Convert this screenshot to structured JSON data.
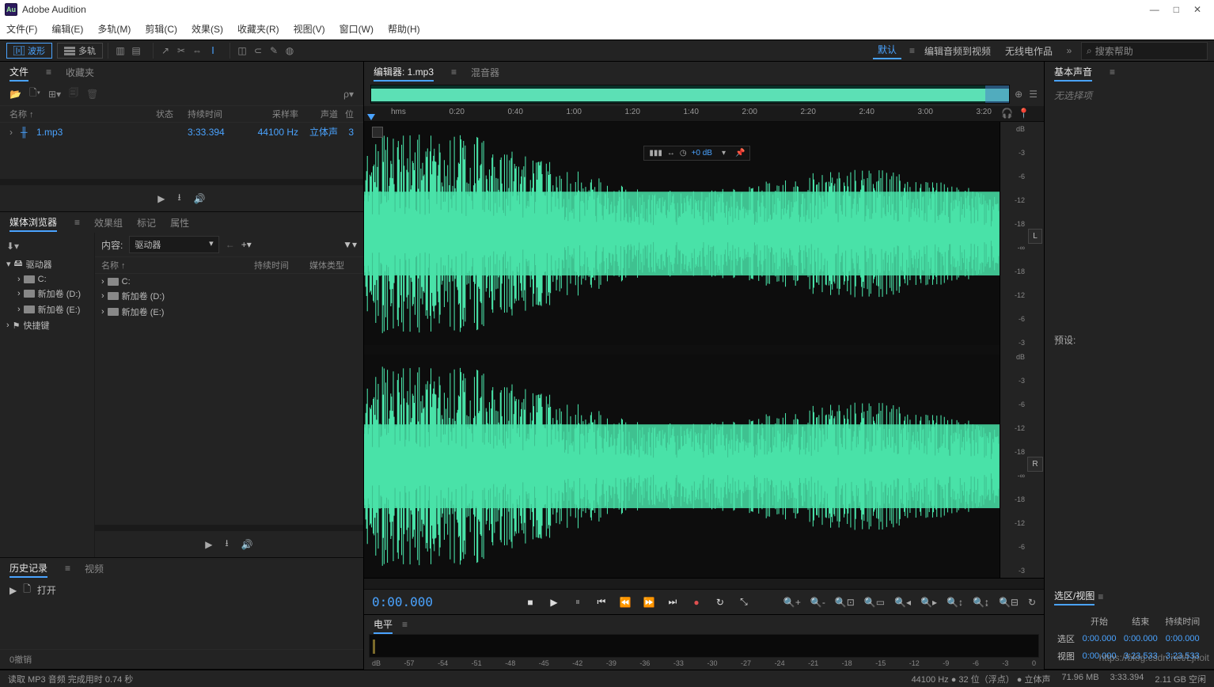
{
  "app": {
    "title": "Adobe Audition",
    "logo": "Au"
  },
  "menu": [
    "文件(F)",
    "编辑(E)",
    "多轨(M)",
    "剪辑(C)",
    "效果(S)",
    "收藏夹(R)",
    "视图(V)",
    "窗口(W)",
    "帮助(H)"
  ],
  "modes": {
    "waveform": "波形",
    "multitrack": "多轨"
  },
  "workspaces": [
    "默认",
    "编辑音频到视频",
    "无线电作品"
  ],
  "search_placeholder": "搜索帮助",
  "files_panel": {
    "tabs": [
      "文件",
      "收藏夹"
    ],
    "headers": {
      "name": "名称 ↑",
      "status": "状态",
      "duration": "持续时间",
      "sample": "采样率",
      "channels": "声道",
      "bit": "位"
    },
    "row": {
      "name": "1.mp3",
      "duration": "3:33.394",
      "sample": "44100 Hz",
      "channels": "立体声",
      "bit": "3"
    }
  },
  "media_browser": {
    "tabs": [
      "媒体浏览器",
      "效果组",
      "标记",
      "属性"
    ],
    "content_label": "内容:",
    "selected": "驱动器",
    "tree": [
      {
        "label": "驱动器"
      },
      {
        "label": "C:"
      },
      {
        "label": "新加卷 (D:)"
      },
      {
        "label": "新加卷 (E:)"
      },
      {
        "label": "快捷键"
      }
    ],
    "list": [
      {
        "name": "C:"
      },
      {
        "name": "新加卷 (D:)"
      },
      {
        "name": "新加卷 (E:)"
      }
    ],
    "headers": {
      "name": "名称 ↑",
      "duration": "持续时间",
      "type": "媒体类型"
    }
  },
  "history": {
    "tabs": [
      "历史记录",
      "视频"
    ],
    "item": "打开",
    "undo": "0撤销"
  },
  "editor": {
    "tabs": [
      "编辑器: 1.mp3",
      "混音器"
    ],
    "ruler": [
      "hms",
      "0:20",
      "0:40",
      "1:00",
      "1:20",
      "1:40",
      "2:00",
      "2:20",
      "2:40",
      "3:00",
      "3:20"
    ],
    "volume_badge": "+0 dB",
    "db_labels": [
      "dB",
      "-3",
      "-6",
      "-12",
      "-18",
      "-∞",
      "-18",
      "-12",
      "-6",
      "-3"
    ],
    "channels": {
      "L": "L",
      "R": "R"
    }
  },
  "transport": {
    "timecode": "0:00.000"
  },
  "levels": {
    "tab": "电平",
    "scale": [
      "dB",
      "-57",
      "-54",
      "-51",
      "-48",
      "-45",
      "-42",
      "-39",
      "-36",
      "-33",
      "-30",
      "-27",
      "-24",
      "-21",
      "-18",
      "-15",
      "-12",
      "-9",
      "-6",
      "-3",
      "0"
    ]
  },
  "essential_sound": {
    "title": "基本声音",
    "none": "无选择项",
    "preset": "预设:"
  },
  "selection": {
    "title": "选区/视图",
    "cols": [
      "开始",
      "结束",
      "持续时间"
    ],
    "sel": {
      "label": "选区",
      "start": "0:00.000",
      "end": "0:00.000",
      "dur": "0:00.000"
    },
    "view": {
      "label": "视图",
      "start": "0:00.000",
      "end": "3:23.533",
      "dur": "3:23.533"
    }
  },
  "status": {
    "left": "读取 MP3 音频 完成用时 0.74 秒",
    "right": [
      "44100 Hz ● 32 位（浮点） ● 立体声",
      "71.96 MB",
      "3:33.394",
      "2.11 GB 空闲"
    ]
  },
  "watermark": "https://blog.csdn.net/Ljnoit"
}
